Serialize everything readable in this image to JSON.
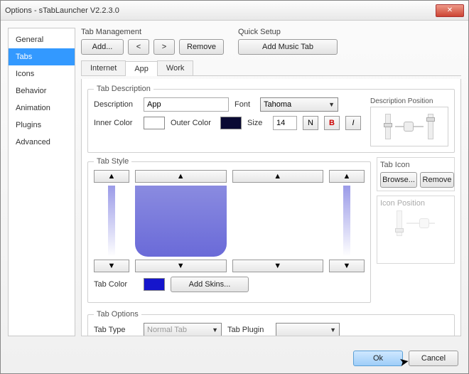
{
  "window": {
    "title": "Options - sTabLauncher V2.2.3.0"
  },
  "sidebar": {
    "items": [
      {
        "label": "General"
      },
      {
        "label": "Tabs"
      },
      {
        "label": "Icons"
      },
      {
        "label": "Behavior"
      },
      {
        "label": "Animation"
      },
      {
        "label": "Plugins"
      },
      {
        "label": "Advanced"
      }
    ],
    "selected_index": 1
  },
  "tab_management": {
    "label": "Tab Management",
    "add": "Add...",
    "prev": "<",
    "next": ">",
    "remove": "Remove"
  },
  "quick_setup": {
    "label": "Quick Setup",
    "add_music": "Add Music Tab"
  },
  "content_tabs": {
    "items": [
      {
        "label": "Internet"
      },
      {
        "label": "App"
      },
      {
        "label": "Work"
      }
    ],
    "active_index": 1
  },
  "tab_description": {
    "legend": "Tab Description",
    "description_label": "Description",
    "description_value": "App",
    "font_label": "Font",
    "font_value": "Tahoma",
    "inner_color_label": "Inner Color",
    "inner_color": "#ffffff",
    "outer_color_label": "Outer Color",
    "outer_color": "#0a0a33",
    "size_label": "Size",
    "size_value": "14",
    "style_normal": "N",
    "style_bold": "B",
    "style_italic": "I",
    "desc_pos_label": "Description Position"
  },
  "tab_style": {
    "legend": "Tab Style",
    "tab_color_label": "Tab Color",
    "tab_color": "#1515cc",
    "add_skins": "Add Skins...",
    "tab_icon_label": "Tab Icon",
    "browse": "Browse...",
    "remove": "Remove",
    "icon_pos_label": "Icon Position",
    "up": "▲",
    "down": "▼"
  },
  "tab_options": {
    "legend": "Tab Options",
    "type_label": "Tab Type",
    "type_value": "Normal Tab",
    "plugin_label": "Tab Plugin",
    "plugin_value": ""
  },
  "footer": {
    "ok": "Ok",
    "cancel": "Cancel"
  }
}
